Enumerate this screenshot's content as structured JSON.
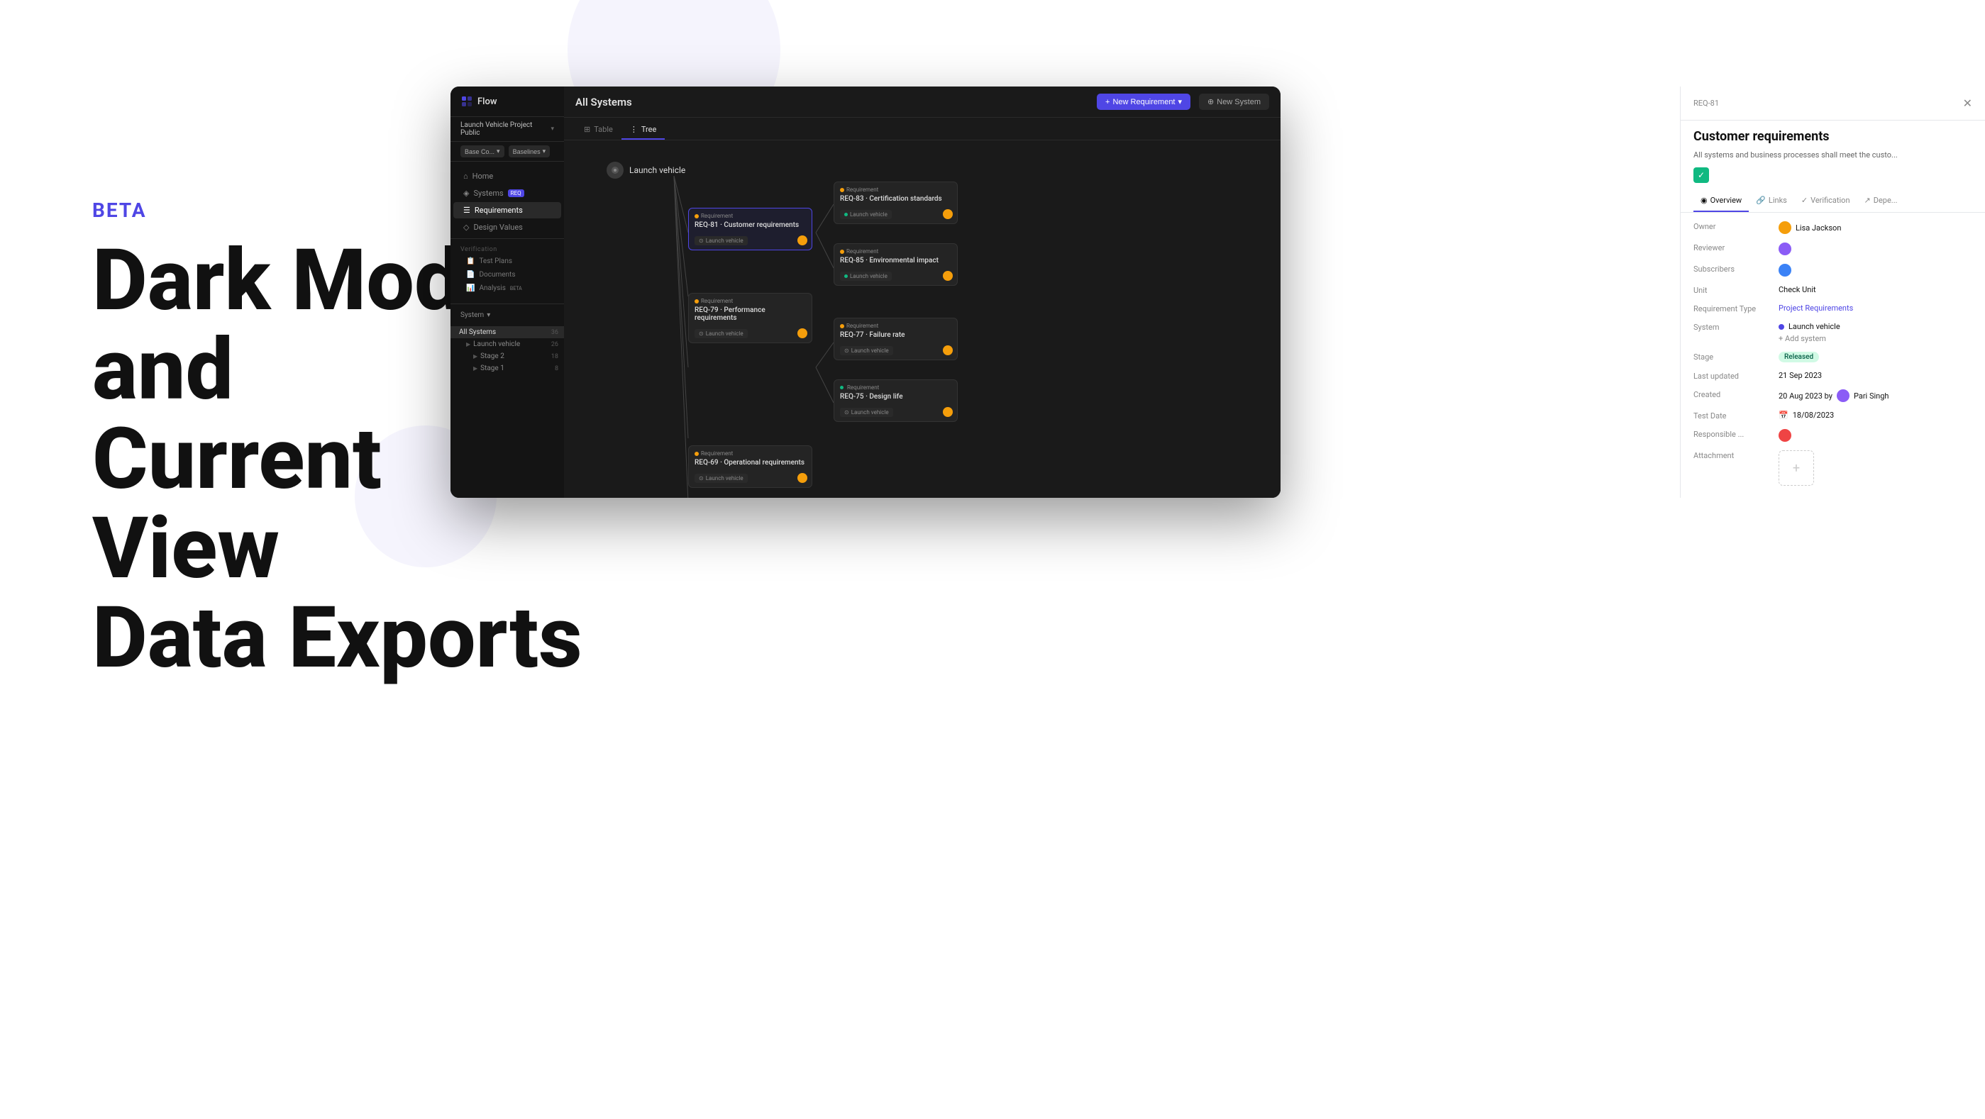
{
  "page": {
    "beta_label": "BETA",
    "heading_line1": "Dark Mode and",
    "heading_line2": "Current View",
    "heading_line3": "Data Exports"
  },
  "app": {
    "title": "Flow",
    "project": "Launch Vehicle Project Public",
    "base_co_label": "Base Co...",
    "baselines_label": "Baselines",
    "nav": {
      "home": "Home",
      "systems": "Systems",
      "systems_badge": "REQ",
      "requirements": "Requirements",
      "design_values": "Design Values",
      "verification_section": "Verification",
      "test_plans": "Test Plans",
      "documents": "Documents",
      "analysis": "Analysis",
      "analysis_badge": "BETA"
    },
    "system_label": "System",
    "tree_items": [
      {
        "label": "All Systems",
        "count": "36",
        "active": true
      },
      {
        "label": "Launch vehicle",
        "count": "26",
        "indent": 1
      },
      {
        "label": "Stage 2",
        "count": "18",
        "indent": 2
      },
      {
        "label": "Stage 1",
        "count": "8",
        "indent": 2
      }
    ],
    "toolbar": {
      "title": "All Systems",
      "new_req_label": "New Requirement",
      "new_system_label": "New System"
    },
    "tabs": [
      {
        "label": "Table",
        "icon": "table-icon",
        "active": false
      },
      {
        "label": "Tree",
        "icon": "tree-icon",
        "active": true
      }
    ],
    "launch_vehicle_node": "Launch vehicle",
    "req_cards": [
      {
        "id": "req-81-card",
        "label": "Requirement",
        "req_id": "REQ-81",
        "title": "Customer requirements",
        "system": "Launch vehicle",
        "highlighted": true,
        "has_avatar": true
      },
      {
        "id": "req-83-card",
        "label": "Requirement",
        "req_id": "REQ-83",
        "title": "Certification standards",
        "system": "Launch vehicle",
        "highlighted": false,
        "has_avatar": true
      },
      {
        "id": "req-85-card",
        "label": "Requirement",
        "req_id": "REQ-85",
        "title": "Environmental impact",
        "system": "Launch vehicle",
        "highlighted": false,
        "has_avatar": true
      },
      {
        "id": "req-79-card",
        "label": "Requirement",
        "req_id": "REQ-79",
        "title": "Performance requirements",
        "system": "Launch vehicle",
        "highlighted": false,
        "has_avatar": true
      },
      {
        "id": "req-77-card",
        "label": "Requirement",
        "req_id": "REQ-77",
        "title": "Failure rate",
        "system": "Launch vehicle",
        "highlighted": false,
        "has_avatar": true
      },
      {
        "id": "req-75-card",
        "label": "Requirement",
        "req_id": "REQ-75",
        "title": "Design life",
        "system": "Launch vehicle",
        "highlighted": false,
        "has_avatar": true
      },
      {
        "id": "req-69-card",
        "label": "Requirement",
        "req_id": "REQ-69",
        "title": "Operational requirements",
        "system": "Launch vehicle",
        "highlighted": false,
        "has_avatar": true
      }
    ]
  },
  "right_panel": {
    "req_id": "REQ-81",
    "title": "Customer requirements",
    "description": "All systems and business processes shall meet the custo...",
    "tabs": [
      {
        "label": "Overview",
        "active": true
      },
      {
        "label": "Links",
        "active": false
      },
      {
        "label": "Verification",
        "active": false
      },
      {
        "label": "Depe...",
        "active": false
      }
    ],
    "fields": {
      "owner_label": "Owner",
      "owner_value": "Lisa Jackson",
      "reviewer_label": "Reviewer",
      "reviewer_value": "",
      "subscribers_label": "Subscribers",
      "subscribers_value": "",
      "unit_label": "Unit",
      "unit_value": "Check Unit",
      "req_type_label": "Requirement Type",
      "req_type_value": "Project Requirements",
      "system_label": "System",
      "system_value": "Launch vehicle",
      "add_system": "+ Add system",
      "stage_label": "Stage",
      "stage_value": "Released",
      "last_updated_label": "Last updated",
      "last_updated_value": "21 Sep 2023",
      "created_label": "Created",
      "created_value": "20 Aug 2023 by",
      "created_by": "Pari Singh",
      "test_date_label": "Test Date",
      "test_date_value": "18/08/2023",
      "responsible_label": "Responsible ...",
      "responsible_value": "",
      "attachment_label": "Attachment"
    }
  }
}
